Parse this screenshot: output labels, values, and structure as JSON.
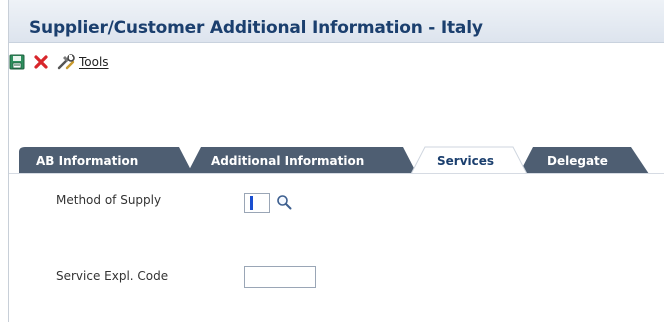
{
  "window": {
    "title": "Supplier/Customer Additional Information - Italy"
  },
  "toolbar": {
    "save_icon": "floppy-save-icon",
    "cancel_icon": "red-x-cancel-icon",
    "tools_icon": "tools-icon",
    "tools_label": "Tools"
  },
  "tabs": [
    {
      "label": "AB Information",
      "active": false
    },
    {
      "label": "Additional Information",
      "active": false
    },
    {
      "label": "Services",
      "active": true
    },
    {
      "label": "Delegate",
      "active": false
    }
  ],
  "form": {
    "method_of_supply": {
      "label": "Method of Supply",
      "value": ""
    },
    "service_expl_code": {
      "label": "Service Expl. Code",
      "value": ""
    }
  },
  "colors": {
    "title": "#1b3f6e",
    "tab_inactive": "#4e5e72",
    "tab_active": "#ffffff",
    "cancel_red": "#d8262b"
  }
}
